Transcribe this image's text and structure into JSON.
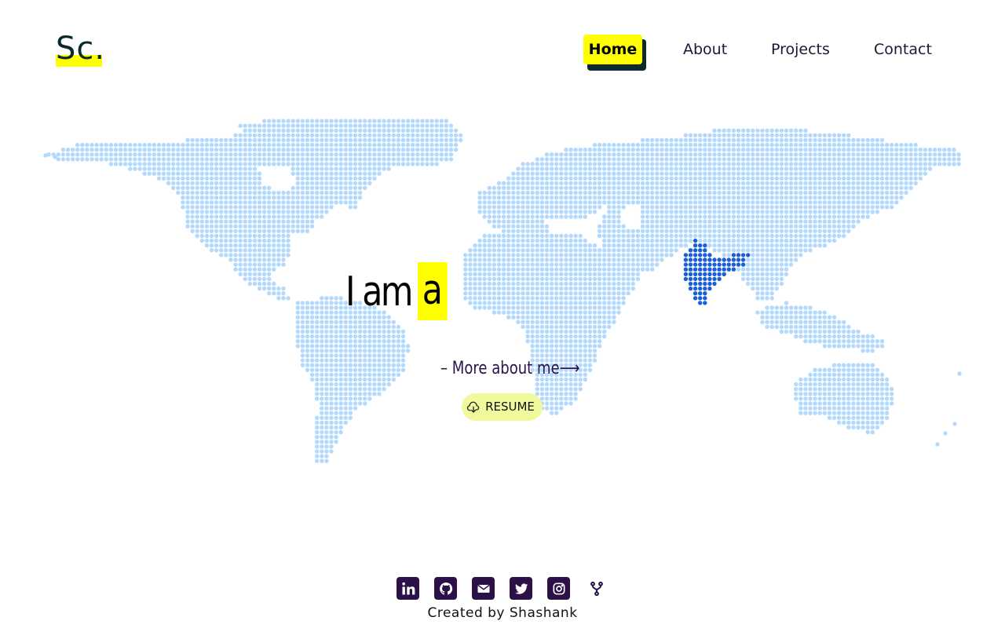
{
  "brand": {
    "logo_text": "Sc.",
    "accent": "#ffff00",
    "dark": "#0d2a2e"
  },
  "nav": {
    "items": [
      {
        "label": "Home",
        "active": true
      },
      {
        "label": "About",
        "active": false
      },
      {
        "label": "Projects",
        "active": false
      },
      {
        "label": "Contact",
        "active": false
      }
    ]
  },
  "hero": {
    "intro": "I am",
    "typed_word": "a",
    "more_link": "– More about me⟶",
    "resume_label": "RESUME",
    "resume_icon": "cloud-download-icon",
    "resume_bg": "#f0fa9c"
  },
  "map": {
    "dot_color": "#b3d9fc",
    "highlight_color": "#1a5fd6",
    "highlight_region": "India"
  },
  "footer": {
    "social": [
      "linkedin-icon",
      "github-icon",
      "mail-icon",
      "twitter-icon",
      "instagram-icon",
      "fork-icon"
    ],
    "credit": "Created by Shashank",
    "icon_bg": "#2b1147"
  }
}
